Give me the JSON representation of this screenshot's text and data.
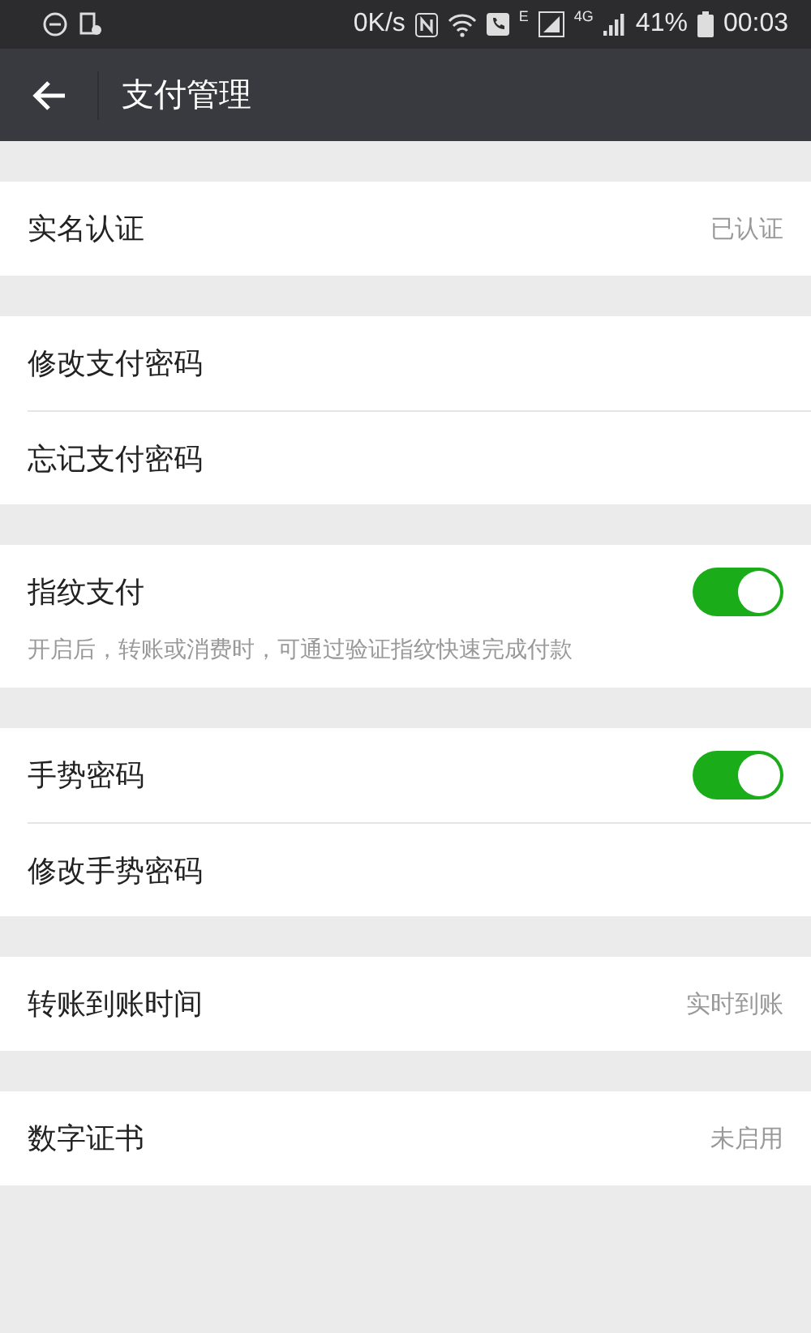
{
  "status_bar": {
    "speed": "0K/s",
    "network_small": "E",
    "network_type": "4G",
    "battery": "41%",
    "time": "00:03"
  },
  "header": {
    "title": "支付管理"
  },
  "groups": [
    {
      "items": [
        {
          "kind": "value",
          "label": "实名认证",
          "value": "已认证"
        }
      ]
    },
    {
      "items": [
        {
          "kind": "link",
          "label": "修改支付密码"
        },
        {
          "kind": "link",
          "label": "忘记支付密码"
        }
      ]
    },
    {
      "items": [
        {
          "kind": "toggle",
          "label": "指纹支付",
          "on": true,
          "description": "开启后，转账或消费时，可通过验证指纹快速完成付款"
        }
      ]
    },
    {
      "items": [
        {
          "kind": "toggle",
          "label": "手势密码",
          "on": true
        },
        {
          "kind": "link",
          "label": "修改手势密码"
        }
      ]
    },
    {
      "items": [
        {
          "kind": "value",
          "label": "转账到账时间",
          "value": "实时到账"
        }
      ]
    },
    {
      "items": [
        {
          "kind": "value",
          "label": "数字证书",
          "value": "未启用"
        }
      ]
    }
  ]
}
